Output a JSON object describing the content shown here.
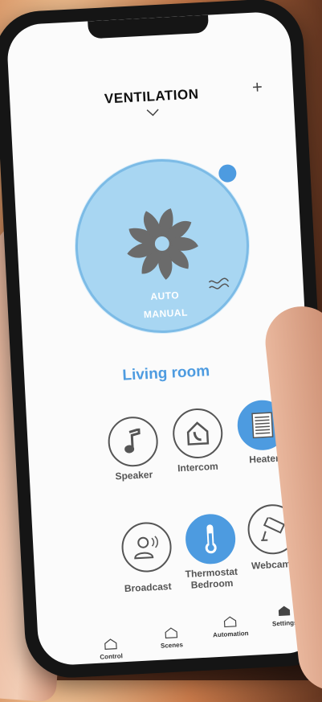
{
  "header": {
    "title": "VENTILATION",
    "add_label": "+"
  },
  "dial": {
    "mode_auto": "AUTO",
    "mode_manual": "MANUAL"
  },
  "room": {
    "name": "Living room"
  },
  "devices": [
    {
      "label": "Speaker",
      "icon": "music-note-icon",
      "active": false
    },
    {
      "label": "Intercom",
      "icon": "intercom-icon",
      "active": false
    },
    {
      "label": "Heater",
      "icon": "heater-icon",
      "active": true
    },
    {
      "label": "Broadcast",
      "icon": "broadcast-icon",
      "active": false
    },
    {
      "label": "Thermostat Bedroom",
      "icon": "thermometer-icon",
      "active": true
    },
    {
      "label": "Webcams",
      "icon": "webcam-icon",
      "active": false
    }
  ],
  "nav": [
    {
      "label": "Control"
    },
    {
      "label": "Scenes"
    },
    {
      "label": "Automation"
    },
    {
      "label": "Settings"
    }
  ],
  "colors": {
    "accent": "#4d9be0",
    "dial": "#a8d6f2"
  }
}
